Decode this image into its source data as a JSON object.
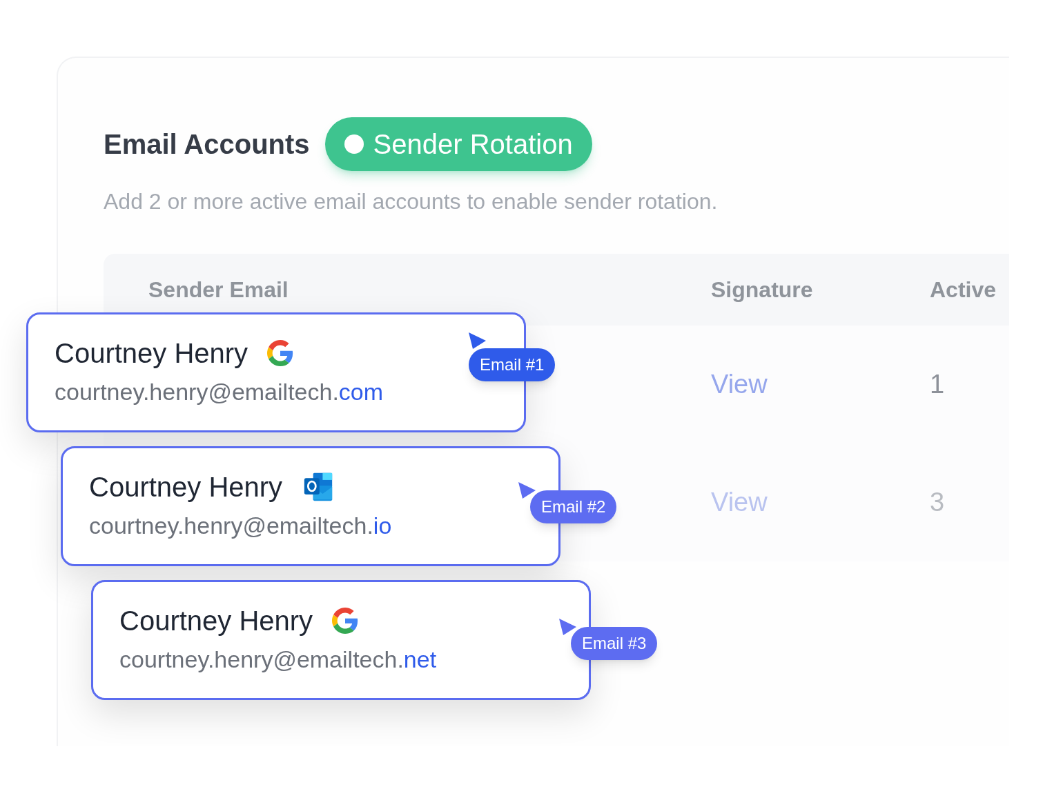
{
  "header": {
    "title": "Email Accounts",
    "badge": "Sender Rotation",
    "description": "Add 2 or more active email accounts to enable sender rotation."
  },
  "table": {
    "columns": [
      "Sender Email",
      "Signature",
      "Active"
    ],
    "rows": [
      {
        "signature": "View",
        "active": "1",
        "dimmed": false
      },
      {
        "signature": "View",
        "active": "3",
        "dimmed": true
      }
    ]
  },
  "accounts": [
    {
      "name": "Courtney Henry",
      "kind": "google",
      "email_base": "courtney.henry@emailtech.",
      "email_tld": "com",
      "label": "Email #1",
      "color": "#2f5bea"
    },
    {
      "name": "Courtney Henry",
      "kind": "outlook",
      "email_base": "courtney.henry@emailtech.",
      "email_tld": "io",
      "label": "Email #2",
      "color": "#5d6cf1"
    },
    {
      "name": "Courtney Henry",
      "kind": "google",
      "email_base": "courtney.henry@emailtech.",
      "email_tld": "net",
      "label": "Email #3",
      "color": "#5d6cf1"
    }
  ]
}
